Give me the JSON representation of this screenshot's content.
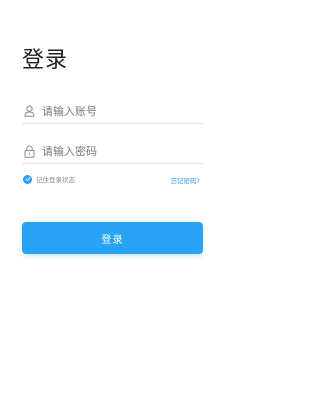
{
  "page": {
    "title": "登录"
  },
  "form": {
    "account_placeholder": "请输入账号",
    "account_value": "",
    "password_placeholder": "请输入密码",
    "password_value": "",
    "remember_label": "记住登录状态",
    "remember_checked": true,
    "forgot_label": "忘记密码?",
    "login_label": "登录"
  },
  "icons": {
    "account": "user-icon",
    "password": "lock-icon",
    "remember": "check-icon"
  },
  "colors": {
    "accent": "#29a3f5",
    "title": "#222222",
    "placeholder": "#7a7a7a",
    "muted": "#8a8a8a",
    "divider": "#e6e6e6"
  }
}
